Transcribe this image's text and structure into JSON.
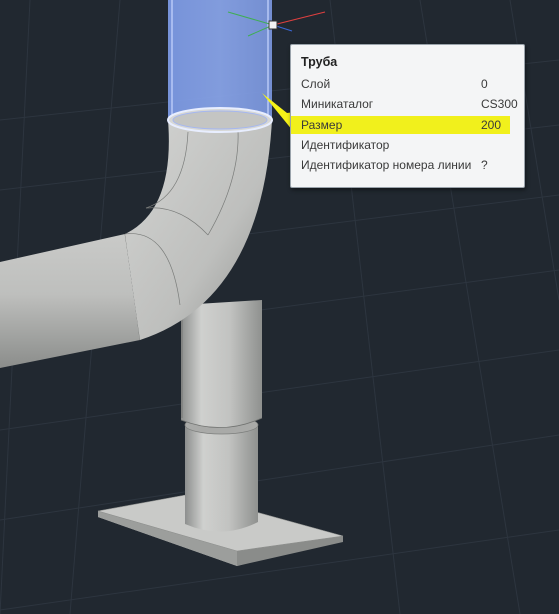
{
  "tooltip": {
    "title": "Труба",
    "rows": [
      {
        "label": "Слой",
        "value": "0"
      },
      {
        "label": "Миникаталог",
        "value": "CS300"
      },
      {
        "label": "Размер",
        "value": "200",
        "highlighted": true
      },
      {
        "label": "Идентификатор",
        "value": ""
      },
      {
        "label": "Идентификатор номера линии",
        "value": "?"
      }
    ]
  },
  "colors": {
    "background": "#212830",
    "grid": "#2e3640",
    "pipe": "#bdbdbb",
    "selected_pipe": "#7f9de8",
    "highlight": "#f1f01c"
  },
  "icons": {
    "ucs_icon": "ucs-axes-icon",
    "grip": "grip-square-icon",
    "callout": "callout-arrow-icon"
  }
}
